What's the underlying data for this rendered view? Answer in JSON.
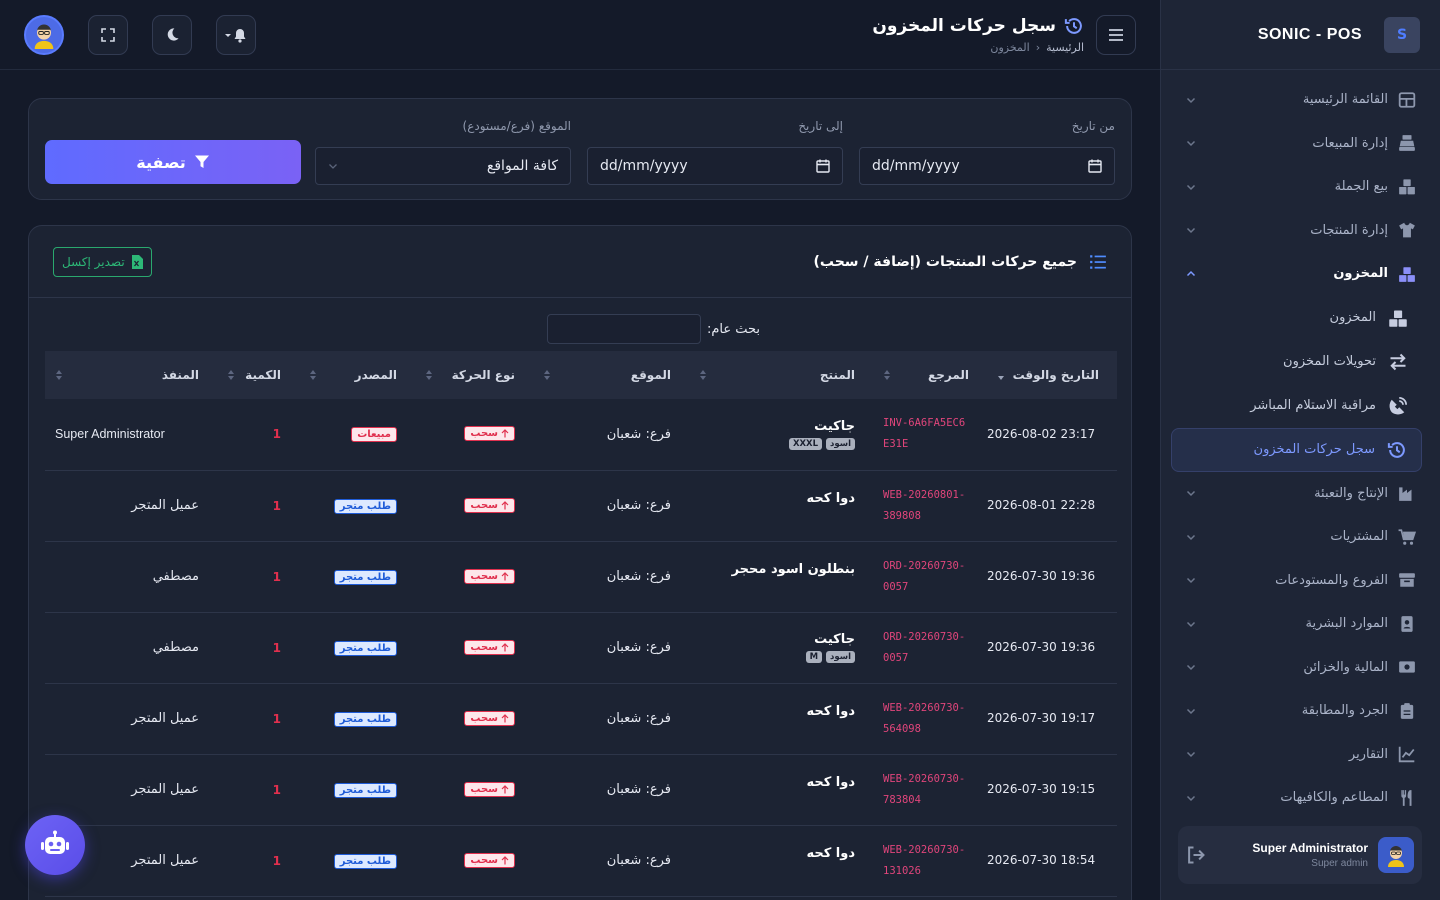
{
  "brand": {
    "name": "SONIC - POS"
  },
  "sidebar": {
    "items": [
      {
        "label": "القائمة الرئيسية",
        "icon": "dashboard-icon"
      },
      {
        "label": "إدارة المبيعات",
        "icon": "cash-register-icon"
      },
      {
        "label": "بيع الجملة",
        "icon": "boxes-icon"
      },
      {
        "label": "إدارة المنتجات",
        "icon": "shirt-icon"
      },
      {
        "label": "المخزون",
        "icon": "inventory-icon",
        "open": true
      },
      {
        "label": "الإنتاج والتعبئة",
        "icon": "industry-icon"
      },
      {
        "label": "المشتريات",
        "icon": "cart-icon"
      },
      {
        "label": "الفروع والمستودعات",
        "icon": "warehouse-icon"
      },
      {
        "label": "الموارد البشرية",
        "icon": "id-badge-icon"
      },
      {
        "label": "المالية والخزائن",
        "icon": "money-icon"
      },
      {
        "label": "الجرد والمطابقة",
        "icon": "clipboard-icon"
      },
      {
        "label": "التقارير",
        "icon": "chart-line-icon"
      },
      {
        "label": "المطاعم والكافيهات",
        "icon": "utensils-icon"
      }
    ],
    "sub_items": [
      {
        "label": "المخزون",
        "icon": "inventory-icon"
      },
      {
        "label": "تحويلات المخزون",
        "icon": "transfer-icon"
      },
      {
        "label": "مراقبة الاستلام المباشر",
        "icon": "satellite-icon"
      },
      {
        "label": "سجل حركات المخزون",
        "icon": "history-icon",
        "active": true
      }
    ],
    "user": {
      "name": "Super Administrator",
      "role": "Super admin"
    }
  },
  "header": {
    "title": "سجل حركات المخزون",
    "breadcrumb_home": "الرئيسية",
    "breadcrumb_current": "المخزون"
  },
  "filters": {
    "from_label": "من تاريخ",
    "from_value": "dd/mm/yyyy",
    "to_label": "إلى تاريخ",
    "to_value": "dd/mm/yyyy",
    "location_label": "الموقع (فرع/مستودع)",
    "location_value": "كافة المواقع",
    "filter_button": "تصفية"
  },
  "table_card": {
    "title": "جميع حركات المنتجات (إضافة / سحب)",
    "export_label": "تصدير إكسل",
    "search_label": "بحث عام:",
    "columns": [
      "التاريخ والوقت",
      "المرجع",
      "المنتج",
      "الموقع",
      "نوع الحركة",
      "المصدر",
      "الكمية",
      "المنفذ"
    ],
    "rows": [
      {
        "date": "2026-08-02 23:17",
        "ref": "INV-6A6FA5EC6E31E",
        "product": "جاكيت",
        "tags": [
          "XXXL",
          "اسود"
        ],
        "location": "فرع: شعبان",
        "type": "سحب",
        "source": "مبيعات",
        "source_kind": "sale",
        "qty": "1",
        "executor": "Super Administrator"
      },
      {
        "date": "2026-08-01 22:28",
        "ref": "WEB-20260801-389808",
        "product": "دوا كحه",
        "tags": [],
        "location": "فرع: شعبان",
        "type": "سحب",
        "source": "طلب متجر",
        "source_kind": "order",
        "qty": "1",
        "executor": "عميل المتجر"
      },
      {
        "date": "2026-07-30 19:36",
        "ref": "ORD-20260730-0057",
        "product": "بنطلون اسود محجر",
        "tags": [],
        "location": "فرع: شعبان",
        "type": "سحب",
        "source": "طلب متجر",
        "source_kind": "order",
        "qty": "1",
        "executor": "مصطفي"
      },
      {
        "date": "2026-07-30 19:36",
        "ref": "ORD-20260730-0057",
        "product": "جاكيت",
        "tags": [
          "M",
          "اسود"
        ],
        "location": "فرع: شعبان",
        "type": "سحب",
        "source": "طلب متجر",
        "source_kind": "order",
        "qty": "1",
        "executor": "مصطفي"
      },
      {
        "date": "2026-07-30 19:17",
        "ref": "WEB-20260730-564098",
        "product": "دوا كحه",
        "tags": [],
        "location": "فرع: شعبان",
        "type": "سحب",
        "source": "طلب متجر",
        "source_kind": "order",
        "qty": "1",
        "executor": "عميل المتجر"
      },
      {
        "date": "2026-07-30 19:15",
        "ref": "WEB-20260730-783804",
        "product": "دوا كحه",
        "tags": [],
        "location": "فرع: شعبان",
        "type": "سحب",
        "source": "طلب متجر",
        "source_kind": "order",
        "qty": "1",
        "executor": "عميل المتجر"
      },
      {
        "date": "2026-07-30 18:54",
        "ref": "WEB-20260730-131026",
        "product": "دوا كحه",
        "tags": [],
        "location": "فرع: شعبان",
        "type": "سحب",
        "source": "طلب متجر",
        "source_kind": "order",
        "qty": "1",
        "executor": "عميل المتجر"
      }
    ]
  }
}
